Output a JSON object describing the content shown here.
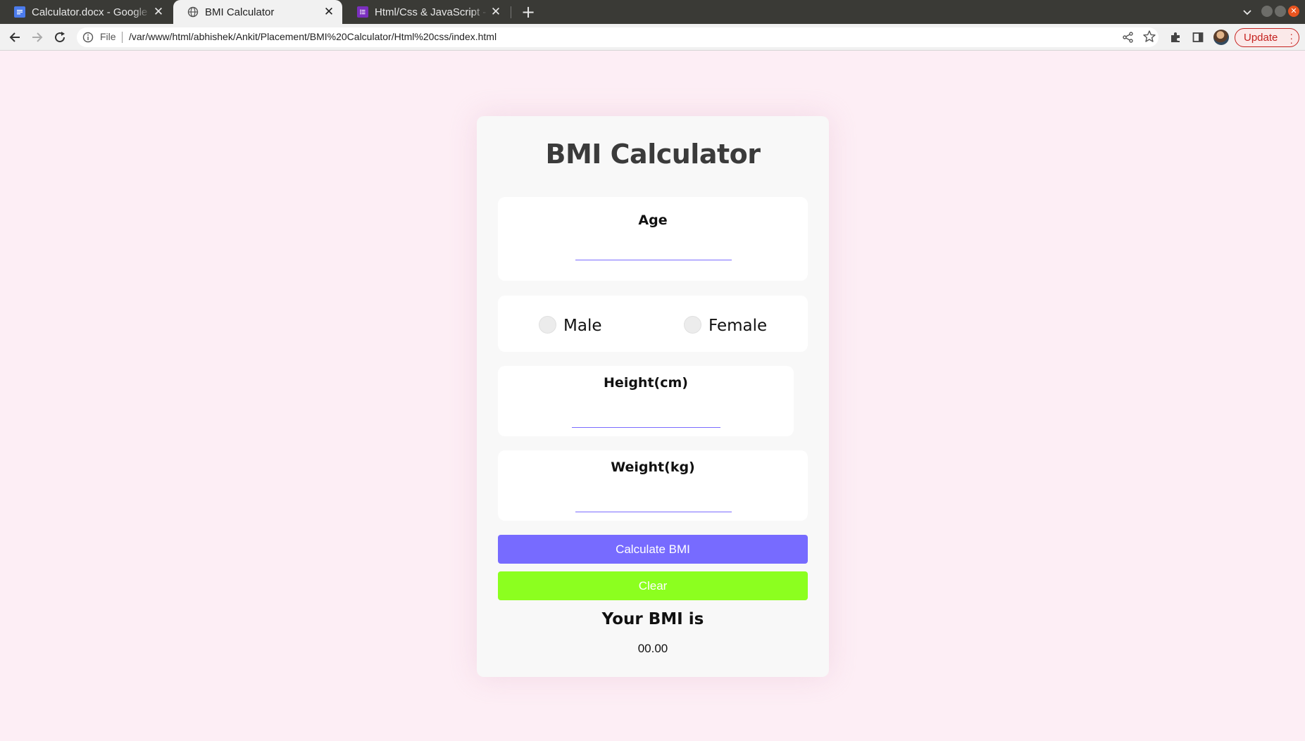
{
  "browser": {
    "tabs": [
      {
        "label": "Calculator.docx - Google Docs",
        "icon": "docs-icon",
        "active": false
      },
      {
        "label": "BMI Calculator",
        "icon": "globe-icon",
        "active": true
      },
      {
        "label": "Html/Css & JavaScript - BMI",
        "icon": "forms-icon",
        "active": false
      }
    ],
    "close_glyph": "✕",
    "new_tab_glyph": "+",
    "address": {
      "scheme_label": "File",
      "url": "/var/www/html/abhishek/Ankit/Placement/BMI%20Calculator/Html%20css/index.html"
    },
    "update_label": "Update",
    "colors": {
      "tabstrip": "#3a3a36",
      "toolbar": "#f1f1f1",
      "update": "#c5221f"
    }
  },
  "page": {
    "title": "BMI Calculator",
    "age": {
      "label": "Age",
      "value": ""
    },
    "gender": {
      "options": [
        "Male",
        "Female"
      ]
    },
    "height": {
      "label": "Height(cm)",
      "value": ""
    },
    "weight": {
      "label": "Weight(kg)",
      "value": ""
    },
    "calculate_label": "Calculate BMI",
    "clear_label": "Clear",
    "result_title": "Your BMI is",
    "result_value": "00.00",
    "colors": {
      "background": "#fdeef5",
      "card": "#f8f8f8",
      "calculate": "#776bff",
      "clear": "#8cff1f",
      "input_underline": "#7b6cff"
    }
  }
}
